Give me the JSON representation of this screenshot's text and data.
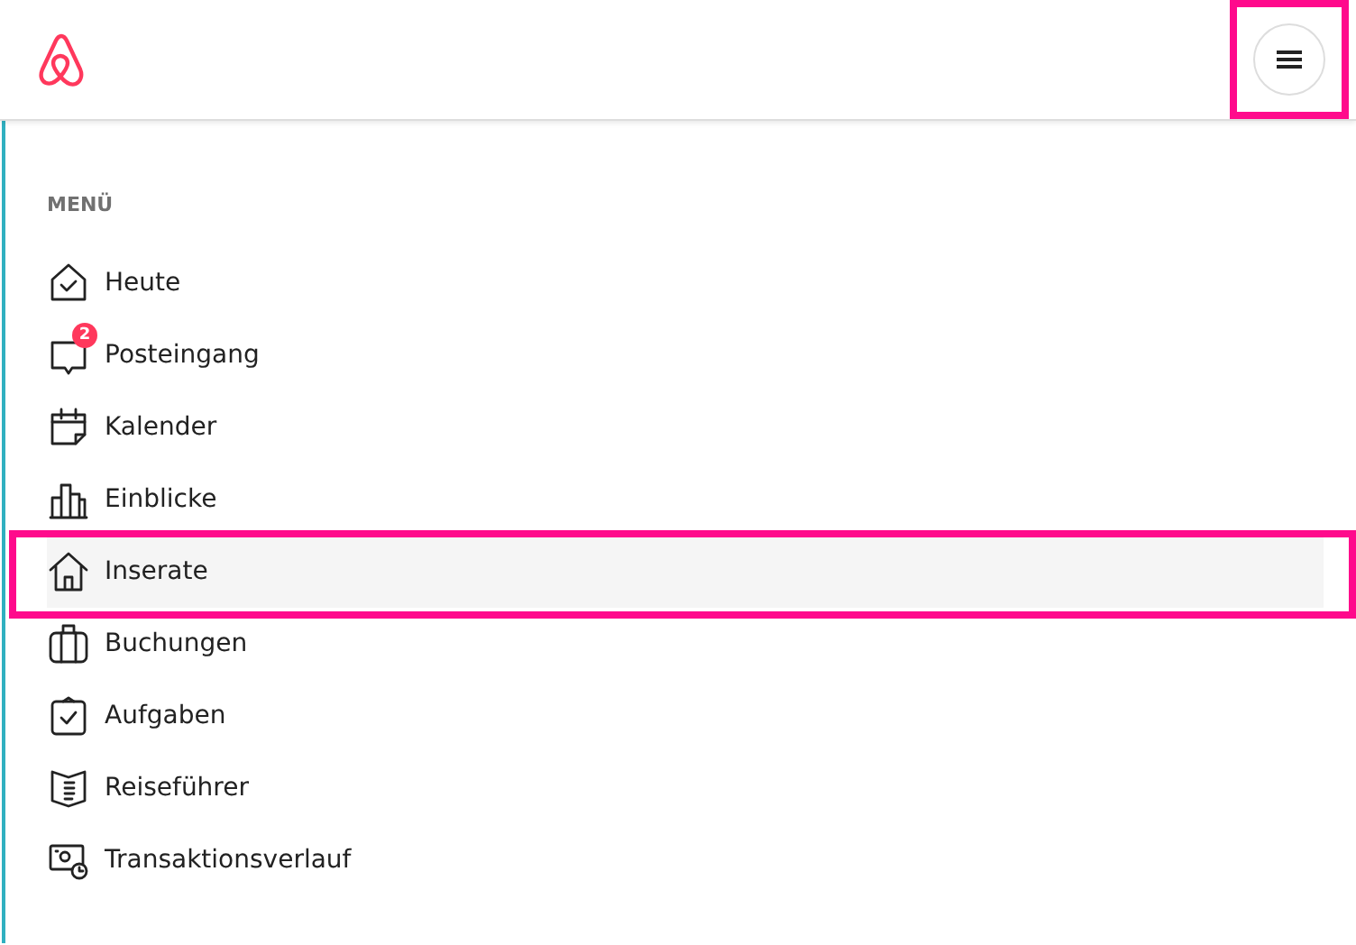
{
  "header": {
    "menu_button": {
      "highlighted": true
    }
  },
  "menu": {
    "heading": "MENÜ",
    "items": [
      {
        "label": "Heute",
        "selected": false,
        "highlighted": false
      },
      {
        "label": "Posteingang",
        "selected": false,
        "highlighted": false,
        "badge": "2"
      },
      {
        "label": "Kalender",
        "selected": false,
        "highlighted": false
      },
      {
        "label": "Einblicke",
        "selected": false,
        "highlighted": false
      },
      {
        "label": "Inserate",
        "selected": true,
        "highlighted": true
      },
      {
        "label": "Buchungen",
        "selected": false,
        "highlighted": false
      },
      {
        "label": "Aufgaben",
        "selected": false,
        "highlighted": false
      },
      {
        "label": "Reiseführer",
        "selected": false,
        "highlighted": false
      },
      {
        "label": "Transaktionsverlauf",
        "selected": false,
        "highlighted": false
      }
    ]
  }
}
